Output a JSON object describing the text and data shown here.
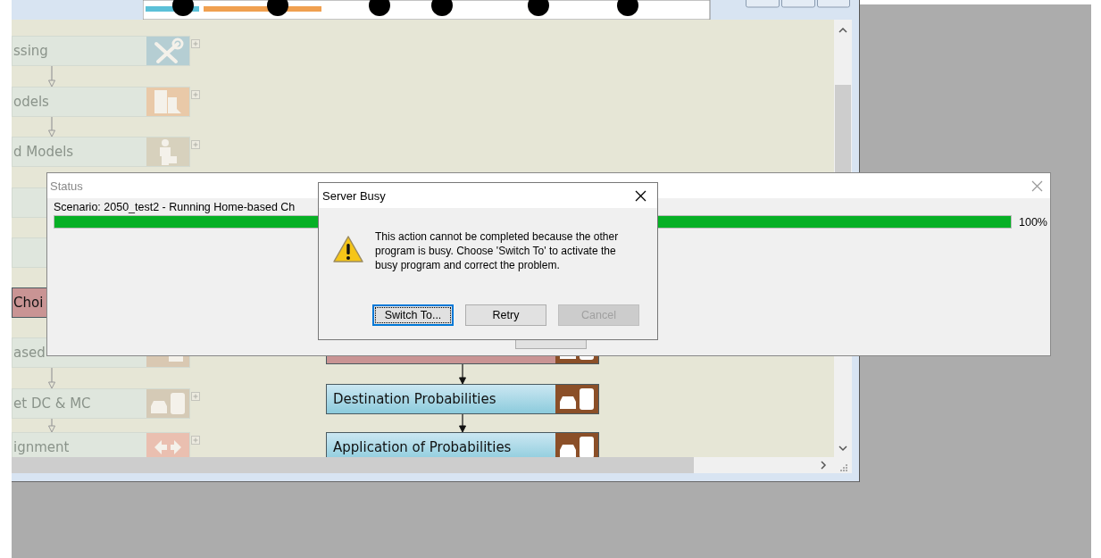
{
  "app_window": {
    "flow_left": [
      {
        "label": "ssing",
        "color": "#dfe6dd",
        "active": false
      },
      {
        "label": "odels",
        "color": "#dfe6dd",
        "active": false
      },
      {
        "label": "d Models",
        "color": "#dfe6dd",
        "active": false
      },
      {
        "color": "#dfe6dd",
        "active": false
      },
      {
        "color": "#dfe6dd",
        "active": false
      },
      {
        "label": "Choi",
        "color": "#c99494",
        "active": true
      },
      {
        "label": "ased",
        "color": "#dfe6dd",
        "active": false
      },
      {
        "label": "et DC & MC",
        "color": "#dfe6dd",
        "active": false
      },
      {
        "label": "ignment",
        "color": "#dfe6dd",
        "active": false
      }
    ],
    "flow_right": [
      {
        "color": "#c99494",
        "active": true
      },
      {
        "label": "Destination Probabilities",
        "color": "#8ccbdc",
        "active": true
      },
      {
        "label": "Application of Probabilities",
        "color": "#8ccbdc",
        "active": true
      }
    ]
  },
  "status_dialog": {
    "title": "Status",
    "message": "Scenario: 2050_test2 - Running Home-based Ch",
    "progress": {
      "level": 1,
      "reading": "100%"
    }
  },
  "busy_dialog": {
    "title": "Server Busy",
    "message": "This action cannot be completed because the other program is busy. Choose 'Switch To' to activate the busy program and correct the problem.",
    "buttons": [
      {
        "label": "Switch To...",
        "focused": true,
        "disabled": false
      },
      {
        "label": "Retry",
        "focused": false,
        "disabled": false
      },
      {
        "label": "Cancel",
        "focused": false,
        "disabled": true
      }
    ]
  }
}
